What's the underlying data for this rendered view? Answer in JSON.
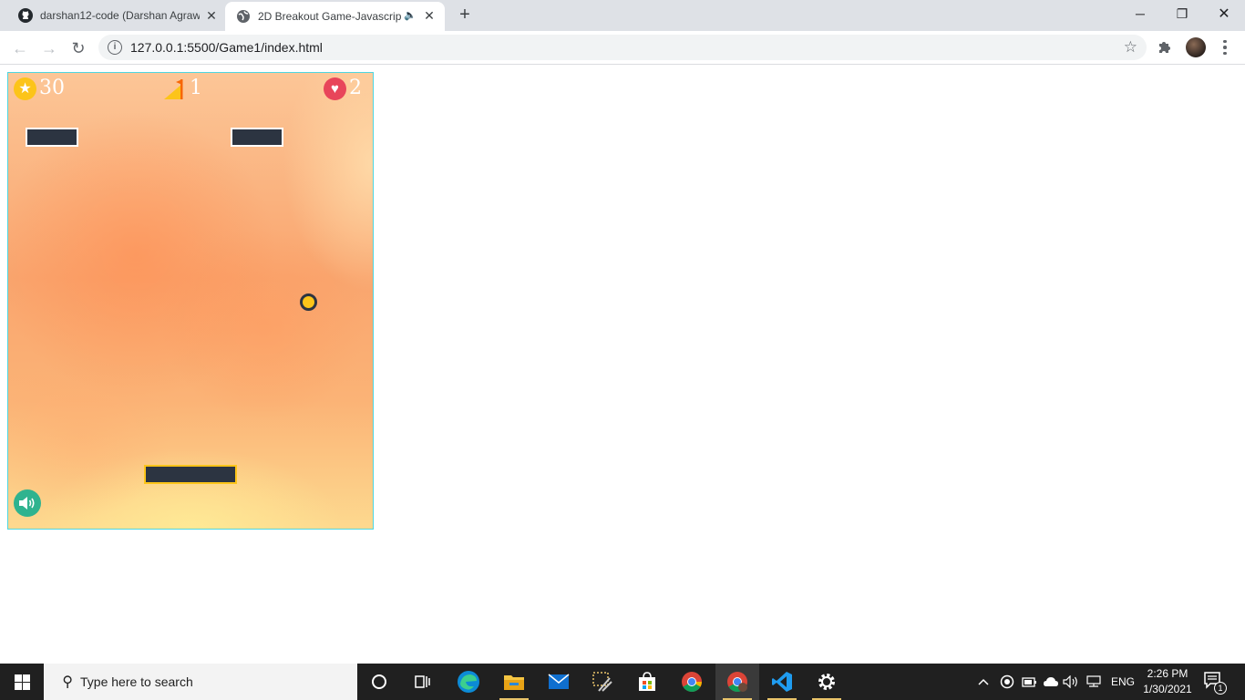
{
  "browser": {
    "tabs": [
      {
        "title": "darshan12-code (Darshan Agraw",
        "close": "✕"
      },
      {
        "title": "2D Breakout Game-Javascrip",
        "close": "✕",
        "audio": "🔈"
      }
    ],
    "new_tab": "+",
    "window_controls": {
      "minimize": "─",
      "maximize": "❐",
      "close": "✕"
    },
    "nav": {
      "back": "←",
      "forward": "→",
      "reload": "↻"
    },
    "url": "127.0.0.1:5500/Game1/index.html",
    "info": "i",
    "star": "☆",
    "extensions": "🧩"
  },
  "game": {
    "score": "30",
    "level": "1",
    "lives": "2",
    "score_icon": "★",
    "lives_icon": "♥",
    "colors": {
      "brick": "#2c3441",
      "ball": "#fcc419",
      "paddle_border": "#fcc419",
      "sound": "#2fb38f",
      "canvas_border": "#4ed6e0"
    }
  },
  "taskbar": {
    "search_placeholder": "Type here to search",
    "search_icon": "⚲",
    "apps": [
      "cortana-icon",
      "task-view-icon",
      "edge-icon",
      "file-explorer-icon",
      "mail-icon",
      "snipping-tool-icon",
      "store-icon",
      "chrome-icon",
      "chrome-active-icon",
      "vscode-icon",
      "settings-icon"
    ],
    "tray": {
      "chevron": "^",
      "language": "ENG"
    },
    "time": "2:26 PM",
    "date": "1/30/2021",
    "notifications": "1"
  }
}
